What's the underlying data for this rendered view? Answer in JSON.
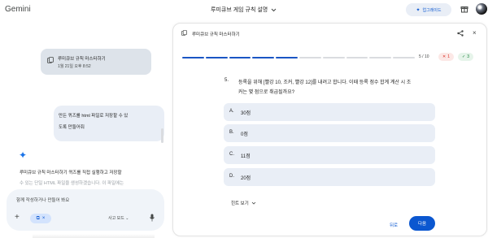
{
  "app": {
    "brand": "Gemini"
  },
  "header": {
    "conversation_title": "루미큐브 게임 규칙 설명",
    "upgrade_label": "업그레이드"
  },
  "chat": {
    "artifact_card": {
      "title": "루미큐브 규칙 마스터하기",
      "date": "1월 21일 오후 8:52"
    },
    "user_message": {
      "line1": "만든 퀴즈를 html 파일로 저장할 수 있",
      "line2": "도록 만들어줘"
    },
    "response": {
      "line1": "루미큐브 규칙 마스터하기 퀴즈를 직접 실행하고 저장할",
      "line2": "수 있는 단일 HTML 파일을 생성하겠습니다. 이 파일에는"
    },
    "input": {
      "placeholder": "함께 작성하거나 만들어 봐요",
      "mode_label": "사고 모드"
    }
  },
  "panel": {
    "title": "루미큐브 규칙 마스터하기",
    "progress": {
      "current": 5,
      "total": 10,
      "text": "5 / 10"
    },
    "wrong_count": "1",
    "correct_count": "3",
    "question": {
      "number": "5.",
      "line1": "등록을 위해 [빨강 10, 조커, 빨강 12]를 내려고 합니다. 이때 등록 점수 합계 계산 시 조",
      "line2": "커는 몇 점으로 취급될까요?"
    },
    "options": [
      {
        "letter": "A.",
        "text": "30점"
      },
      {
        "letter": "B.",
        "text": "0점"
      },
      {
        "letter": "C.",
        "text": "11점"
      },
      {
        "letter": "D.",
        "text": "20점"
      }
    ],
    "hint_label": "힌트 보기",
    "prev_label": "뒤로",
    "next_label": "다음"
  },
  "colors": {
    "accent": "#0b57d0",
    "progress_active": "#1a56c4",
    "progress_inactive": "#dadce0",
    "wrong": "#d93025",
    "correct": "#188038"
  }
}
